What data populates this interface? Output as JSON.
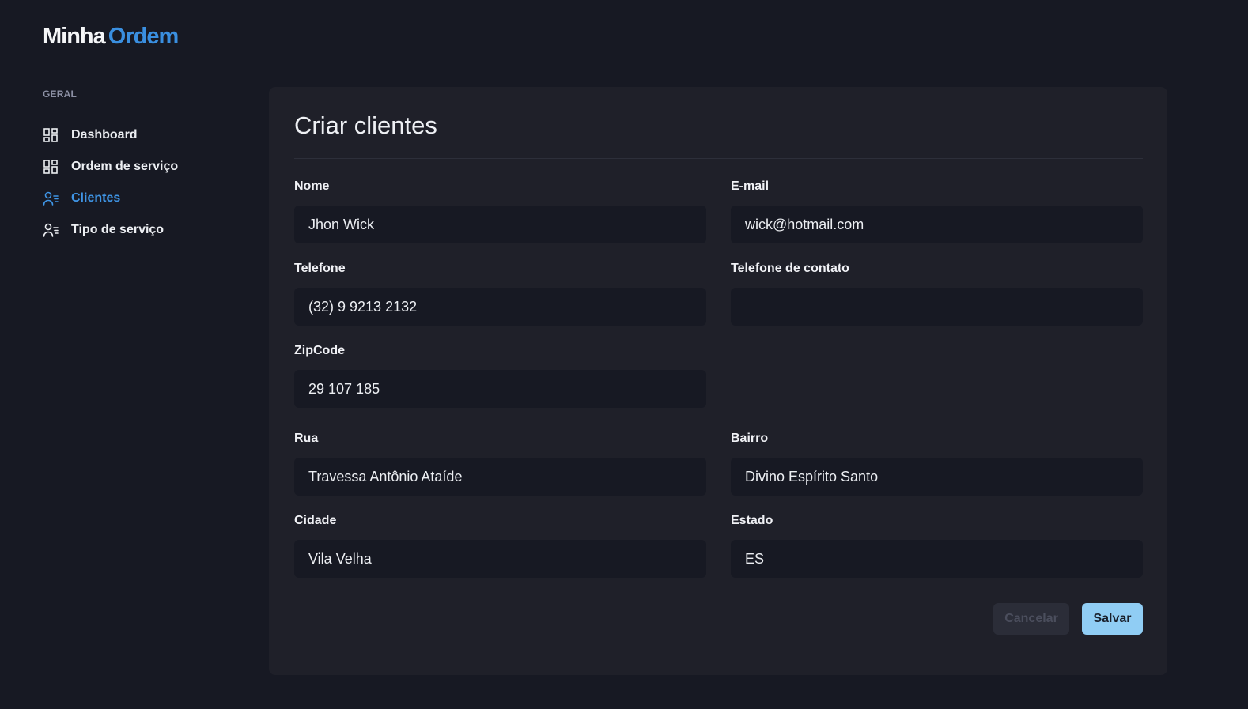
{
  "logo": {
    "part1": "Minha",
    "part2": "Ordem"
  },
  "sidebar": {
    "section": "GERAL",
    "items": [
      {
        "label": "Dashboard",
        "icon": "grid-icon",
        "active": false
      },
      {
        "label": "Ordem de serviço",
        "icon": "grid-icon",
        "active": false
      },
      {
        "label": "Clientes",
        "icon": "user-list-icon",
        "active": true
      },
      {
        "label": "Tipo de serviço",
        "icon": "user-list-icon",
        "active": false
      }
    ]
  },
  "form": {
    "title": "Criar clientes",
    "fields": {
      "nome": {
        "label": "Nome",
        "value": "Jhon Wick"
      },
      "email": {
        "label": "E-mail",
        "value": "wick@hotmail.com"
      },
      "telefone": {
        "label": "Telefone",
        "value": "(32) 9 9213 2132"
      },
      "telefone_contato": {
        "label": "Telefone de contato",
        "value": ""
      },
      "zipcode": {
        "label": "ZipCode",
        "value": "29 107 185"
      },
      "rua": {
        "label": "Rua",
        "value": "Travessa Antônio Ataíde"
      },
      "bairro": {
        "label": "Bairro",
        "value": "Divino Espírito Santo"
      },
      "cidade": {
        "label": "Cidade",
        "value": "Vila Velha"
      },
      "estado": {
        "label": "Estado",
        "value": "ES"
      }
    },
    "buttons": {
      "cancel": "Cancelar",
      "save": "Salvar"
    }
  },
  "colors": {
    "background": "#171923",
    "card": "#1f2029",
    "accent": "#3f95e6",
    "save_button": "#90cdf4"
  }
}
